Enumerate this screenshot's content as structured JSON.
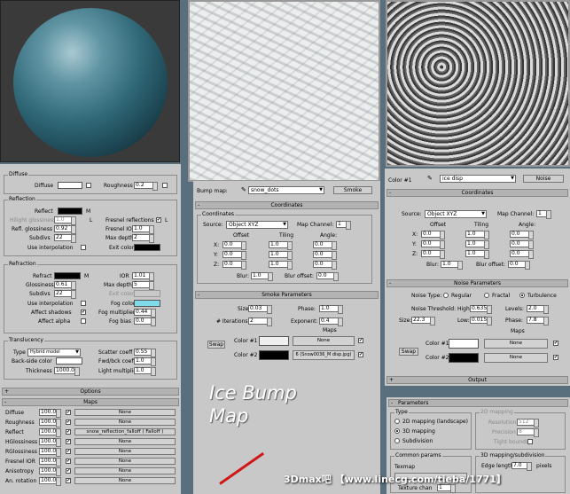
{
  "material": {
    "diffuse": {
      "title": "Diffuse",
      "diffuse_label": "Diffuse",
      "roughness_label": "Roughness",
      "roughness": "0.2"
    },
    "reflection": {
      "title": "Reflection",
      "reflect_label": "Reflect",
      "m": "M",
      "hilight_label": "Hilight glossiness",
      "hilight": "1.0",
      "l": "L",
      "fresnel_label": "Fresnel reflections",
      "refl_gloss_label": "Refl. glossiness",
      "refl_gloss": "0.92",
      "fresnel_ior_label": "Fresnel IOR",
      "fresnel_ior": "1.0",
      "subdivs_label": "Subdivs",
      "subdivs": "22",
      "maxdepth_label": "Max depth",
      "maxdepth": "2",
      "use_interp_label": "Use interpolation",
      "exit_color_label": "Exit color"
    },
    "refraction": {
      "title": "Refraction",
      "refract_label": "Refract",
      "ior_label": "IOR",
      "ior": "1.01",
      "glossiness_label": "Glossiness",
      "glossiness": "0.61",
      "maxdepth_label": "Max depth",
      "maxdepth": "5",
      "subdivs_label": "Subdivs",
      "subdivs": "22",
      "exit_color_label": "Exit color",
      "use_interp_label": "Use interpolation",
      "fog_color_label": "Fog color",
      "fog_color": "#7fdbe9",
      "affect_shadows_label": "Affect shadows",
      "fog_mult_label": "Fog multiplier",
      "fog_mult": "0.44",
      "affect_alpha_label": "Affect alpha",
      "fog_bias_label": "Fog bias",
      "fog_bias": "0.0"
    },
    "translucency": {
      "title": "Translucency",
      "type_label": "Type",
      "type": "Hybrid model",
      "scatter_label": "Scatter coeff",
      "scatter": "0.55",
      "backside_label": "Back-side color",
      "fwd_label": "Fwd/bck coeff",
      "fwd": "1.0",
      "thickness_label": "Thickness",
      "thickness": "1000.0",
      "light_mult_label": "Light multiplier",
      "light_mult": "1.0"
    },
    "options_label": "Options",
    "maps_label": "Maps",
    "maps": [
      {
        "name": "Diffuse",
        "amt": "100.0",
        "map": "None"
      },
      {
        "name": "Roughness",
        "amt": "100.0",
        "map": "None"
      },
      {
        "name": "Reflect",
        "amt": "100.0",
        "map": "snow_reflection_falloff  ( Falloff )"
      },
      {
        "name": "HGlossiness",
        "amt": "100.0",
        "map": "None"
      },
      {
        "name": "RGlossiness",
        "amt": "100.0",
        "map": "None"
      },
      {
        "name": "Fresnel IOR",
        "amt": "100.0",
        "map": "None"
      },
      {
        "name": "Anisotropy",
        "amt": "100.0",
        "map": "None"
      },
      {
        "name": "An. rotation",
        "amt": "100.0",
        "map": "None"
      }
    ]
  },
  "bump": {
    "bump_map_label": "Bump map:",
    "map_name": "snow_dots",
    "type_btn": "Smoke",
    "coords_title": "Coordinates",
    "coords_group": "Coordinates",
    "source_label": "Source:",
    "source": "Object XYZ",
    "map_channel_label": "Map Channel:",
    "map_channel": "1",
    "offset_label": "Offset",
    "tiling_label": "Tiling",
    "angle_label": "Angle:",
    "x": "X:",
    "y": "Y:",
    "z": "Z:",
    "offset": [
      "0.0",
      "0.0",
      "0.0"
    ],
    "tiling": [
      "1.0",
      "1.0",
      "1.0"
    ],
    "angle": [
      "0.0",
      "0.0",
      "0.0"
    ],
    "blur_label": "Blur:",
    "blur": "1.0",
    "blur_offset_label": "Blur offset:",
    "blur_offset": "0.0",
    "smoke_title": "Smoke Parameters",
    "size_label": "Size:",
    "size": "0.03",
    "phase_label": "Phase:",
    "phase": "1.0",
    "iter_label": "# Iterations:",
    "iter": "2",
    "exp_label": "Exponent:",
    "exp": "0.4",
    "maps_label": "Maps",
    "swap": "Swap",
    "color1_label": "Color #1",
    "color1_map": "None",
    "color2_label": "Color #2",
    "color2_map": "6 (Snow0036_M disp.jpg)",
    "overlay_title": "Ice Bump Map"
  },
  "noise": {
    "color1_label": "Color #1",
    "map_name": "ice disp",
    "type_btn": "Noise",
    "coords_title": "Coordinates",
    "source_label": "Source:",
    "source": "Object XYZ",
    "map_channel_label": "Map Channel:",
    "map_channel": "1",
    "offset_label": "Offset",
    "tiling_label": "Tiling",
    "angle_label": "Angle:",
    "x": "X:",
    "y": "Y:",
    "z": "Z:",
    "offset": [
      "0.0",
      "0.0",
      "0.0"
    ],
    "tiling": [
      "1.0",
      "1.0",
      "1.0"
    ],
    "angle": [
      "0.0",
      "0.0",
      "0.0"
    ],
    "blur_label": "Blur:",
    "blur": "1.0",
    "blur_offset_label": "Blur offset:",
    "blur_offset": "0.0",
    "noise_title": "Noise Parameters",
    "noise_type_label": "Noise Type:",
    "regular": "Regular",
    "fractal": "Fractal",
    "turbulence": "Turbulence",
    "threshold_label": "Noise Threshold:",
    "high_label": "High:",
    "high": "0.635",
    "levels_label": "Levels:",
    "levels": "2.0",
    "size_label": "Size:",
    "size": "22.3",
    "low_label": "Low:",
    "low": "0.015",
    "phase_label": "Phase:",
    "phase": "7.8",
    "maps_label": "Maps",
    "swap": "Swap",
    "color1_map": "None",
    "color2_label": "Color #2",
    "color2_map": "None",
    "output_label": "Output"
  },
  "params": {
    "title": "Parameters",
    "type_label": "Type",
    "opt1": "2D mapping (landscape)",
    "opt2": "3D mapping",
    "opt3": "Subdivision",
    "map2d_label": "2D mapping",
    "resolution_label": "Resolution",
    "resolution": "512",
    "precision_label": "Precision",
    "precision": "8",
    "tight_label": "Tight bounds",
    "common_label": "Common params",
    "texmap_label": "Texmap",
    "sub3d_label": "3D mapping/subdivision",
    "edge_label": "Edge length",
    "edge": "7.0",
    "pixels_label": "pixels",
    "texture_chan_label": "Texture chan",
    "texture_chan": "1"
  },
  "watermark": "3Dmax吧 【www.linecg.com/tieba/1771】"
}
